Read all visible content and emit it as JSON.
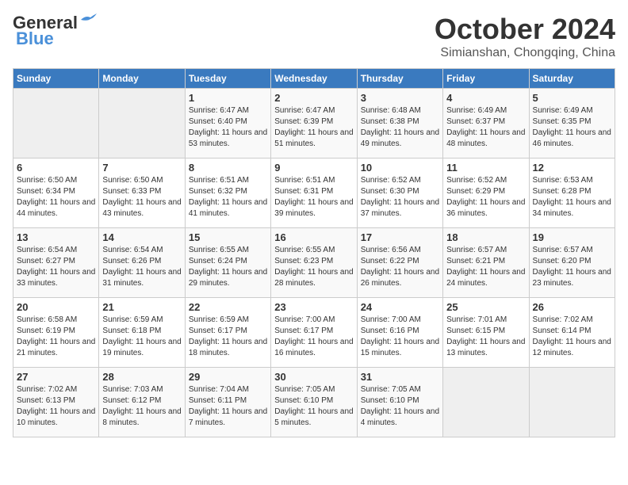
{
  "header": {
    "logo_line1": "General",
    "logo_line2": "Blue",
    "month": "October 2024",
    "location": "Simianshan, Chongqing, China"
  },
  "weekdays": [
    "Sunday",
    "Monday",
    "Tuesday",
    "Wednesday",
    "Thursday",
    "Friday",
    "Saturday"
  ],
  "weeks": [
    [
      {
        "day": "",
        "info": ""
      },
      {
        "day": "",
        "info": ""
      },
      {
        "day": "1",
        "info": "Sunrise: 6:47 AM\nSunset: 6:40 PM\nDaylight: 11 hours and 53 minutes."
      },
      {
        "day": "2",
        "info": "Sunrise: 6:47 AM\nSunset: 6:39 PM\nDaylight: 11 hours and 51 minutes."
      },
      {
        "day": "3",
        "info": "Sunrise: 6:48 AM\nSunset: 6:38 PM\nDaylight: 11 hours and 49 minutes."
      },
      {
        "day": "4",
        "info": "Sunrise: 6:49 AM\nSunset: 6:37 PM\nDaylight: 11 hours and 48 minutes."
      },
      {
        "day": "5",
        "info": "Sunrise: 6:49 AM\nSunset: 6:35 PM\nDaylight: 11 hours and 46 minutes."
      }
    ],
    [
      {
        "day": "6",
        "info": "Sunrise: 6:50 AM\nSunset: 6:34 PM\nDaylight: 11 hours and 44 minutes."
      },
      {
        "day": "7",
        "info": "Sunrise: 6:50 AM\nSunset: 6:33 PM\nDaylight: 11 hours and 43 minutes."
      },
      {
        "day": "8",
        "info": "Sunrise: 6:51 AM\nSunset: 6:32 PM\nDaylight: 11 hours and 41 minutes."
      },
      {
        "day": "9",
        "info": "Sunrise: 6:51 AM\nSunset: 6:31 PM\nDaylight: 11 hours and 39 minutes."
      },
      {
        "day": "10",
        "info": "Sunrise: 6:52 AM\nSunset: 6:30 PM\nDaylight: 11 hours and 37 minutes."
      },
      {
        "day": "11",
        "info": "Sunrise: 6:52 AM\nSunset: 6:29 PM\nDaylight: 11 hours and 36 minutes."
      },
      {
        "day": "12",
        "info": "Sunrise: 6:53 AM\nSunset: 6:28 PM\nDaylight: 11 hours and 34 minutes."
      }
    ],
    [
      {
        "day": "13",
        "info": "Sunrise: 6:54 AM\nSunset: 6:27 PM\nDaylight: 11 hours and 33 minutes."
      },
      {
        "day": "14",
        "info": "Sunrise: 6:54 AM\nSunset: 6:26 PM\nDaylight: 11 hours and 31 minutes."
      },
      {
        "day": "15",
        "info": "Sunrise: 6:55 AM\nSunset: 6:24 PM\nDaylight: 11 hours and 29 minutes."
      },
      {
        "day": "16",
        "info": "Sunrise: 6:55 AM\nSunset: 6:23 PM\nDaylight: 11 hours and 28 minutes."
      },
      {
        "day": "17",
        "info": "Sunrise: 6:56 AM\nSunset: 6:22 PM\nDaylight: 11 hours and 26 minutes."
      },
      {
        "day": "18",
        "info": "Sunrise: 6:57 AM\nSunset: 6:21 PM\nDaylight: 11 hours and 24 minutes."
      },
      {
        "day": "19",
        "info": "Sunrise: 6:57 AM\nSunset: 6:20 PM\nDaylight: 11 hours and 23 minutes."
      }
    ],
    [
      {
        "day": "20",
        "info": "Sunrise: 6:58 AM\nSunset: 6:19 PM\nDaylight: 11 hours and 21 minutes."
      },
      {
        "day": "21",
        "info": "Sunrise: 6:59 AM\nSunset: 6:18 PM\nDaylight: 11 hours and 19 minutes."
      },
      {
        "day": "22",
        "info": "Sunrise: 6:59 AM\nSunset: 6:17 PM\nDaylight: 11 hours and 18 minutes."
      },
      {
        "day": "23",
        "info": "Sunrise: 7:00 AM\nSunset: 6:17 PM\nDaylight: 11 hours and 16 minutes."
      },
      {
        "day": "24",
        "info": "Sunrise: 7:00 AM\nSunset: 6:16 PM\nDaylight: 11 hours and 15 minutes."
      },
      {
        "day": "25",
        "info": "Sunrise: 7:01 AM\nSunset: 6:15 PM\nDaylight: 11 hours and 13 minutes."
      },
      {
        "day": "26",
        "info": "Sunrise: 7:02 AM\nSunset: 6:14 PM\nDaylight: 11 hours and 12 minutes."
      }
    ],
    [
      {
        "day": "27",
        "info": "Sunrise: 7:02 AM\nSunset: 6:13 PM\nDaylight: 11 hours and 10 minutes."
      },
      {
        "day": "28",
        "info": "Sunrise: 7:03 AM\nSunset: 6:12 PM\nDaylight: 11 hours and 8 minutes."
      },
      {
        "day": "29",
        "info": "Sunrise: 7:04 AM\nSunset: 6:11 PM\nDaylight: 11 hours and 7 minutes."
      },
      {
        "day": "30",
        "info": "Sunrise: 7:05 AM\nSunset: 6:10 PM\nDaylight: 11 hours and 5 minutes."
      },
      {
        "day": "31",
        "info": "Sunrise: 7:05 AM\nSunset: 6:10 PM\nDaylight: 11 hours and 4 minutes."
      },
      {
        "day": "",
        "info": ""
      },
      {
        "day": "",
        "info": ""
      }
    ]
  ]
}
